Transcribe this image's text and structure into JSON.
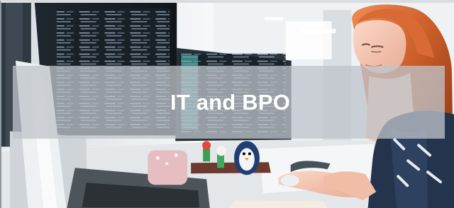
{
  "hero": {
    "title": "IT and BPO"
  }
}
